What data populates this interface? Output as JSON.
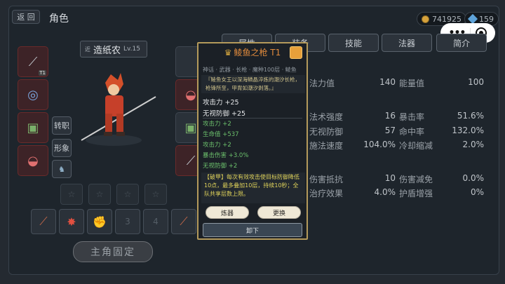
{
  "header": {
    "back_label": "返 回",
    "title": "角色",
    "coins": "741925",
    "gems": "159"
  },
  "tabs": [
    "属性",
    "装备",
    "技能",
    "法器",
    "简介"
  ],
  "character": {
    "tag": "近",
    "name": "造纸农",
    "level": "Lv.15"
  },
  "side_buttons": {
    "transfer": "转职",
    "image": "形象"
  },
  "fixed_button": "主角固定",
  "stats": [
    {
      "label": "法力值",
      "value": "140"
    },
    {
      "label": "能量值",
      "value": "100"
    },
    {
      "label": "法术强度",
      "value": "16"
    },
    {
      "label": "暴击率",
      "value": "51.6%"
    },
    {
      "label": "无视防御",
      "value": "57"
    },
    {
      "label": "命中率",
      "value": "132.0%"
    },
    {
      "label": "施法速度",
      "value": "104.0%"
    },
    {
      "label": "冷却缩减",
      "value": "2.0%"
    },
    {
      "label": "伤害抵抗",
      "value": "10"
    },
    {
      "label": "伤害减免",
      "value": "0.0%"
    },
    {
      "label": "治疗效果",
      "value": "4.0%"
    },
    {
      "label": "护盾增强",
      "value": "0%"
    }
  ],
  "popup": {
    "title": "鲮鱼之枪 T1",
    "meta": "神话 · 武器 · 长枪 · 魔种100层 · 鲮鱼",
    "quote": "『鲮鱼女王以深海鳞晶淬炼的潮汐长枪，枪锋所至，甲胄如潮汐剥落。』",
    "main_attrs": [
      "攻击力 +25",
      "无视防御 +25"
    ],
    "sub_attrs": [
      "攻击力 +2",
      "生命值 +537",
      "攻击力 +2",
      "暴击伤害 +3.0%",
      "无视防御 +2"
    ],
    "desc": "【破甲】每次有效攻击使目标防御降低10点，最多叠加10层，持续10秒；全队共享层数上限。",
    "refine_label": "炼器",
    "replace_label": "更换",
    "unload_label": "卸下"
  },
  "colors": {
    "accent_gold": "#b49a5b",
    "title_orange": "#e08a3c",
    "attr_green": "#6cc06c",
    "desc_yellow": "#e0d35a"
  }
}
